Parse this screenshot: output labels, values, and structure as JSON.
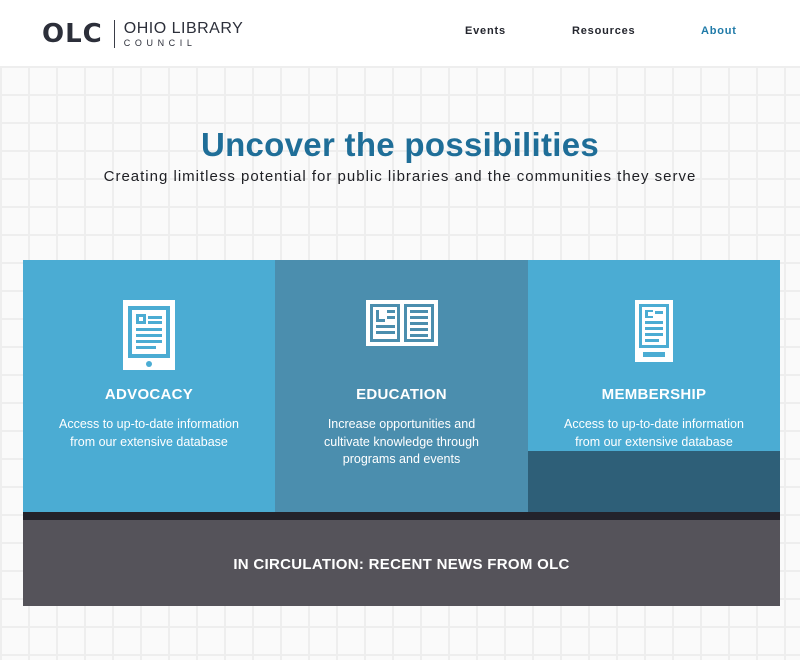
{
  "header": {
    "logo_mark": "OLC",
    "logo_line1": "OHIO LIBRARY",
    "logo_line2": "COUNCIL",
    "nav": [
      {
        "label": "Events"
      },
      {
        "label": "Resources"
      },
      {
        "label": "About"
      }
    ]
  },
  "hero": {
    "title": "Uncover the possibilities",
    "subtitle": "Creating limitless potential for public libraries and the communities they serve"
  },
  "cards": [
    {
      "title": "ADVOCACY",
      "description": "Access to up-to-date information from our extensive database",
      "icon": "tablet-document-icon"
    },
    {
      "title": "EDUCATION",
      "description": "Increase opportunities and cultivate knowledge through programs and events",
      "icon": "open-book-icon"
    },
    {
      "title": "MEMBERSHIP",
      "description": "Access to up-to-date information from our extensive database",
      "icon": "phone-card-icon"
    }
  ],
  "news": {
    "title": "IN CIRCULATION: RECENT NEWS FROM OLC"
  },
  "colors": {
    "accent": "#1f6e98",
    "nav_active": "#1f7aa8",
    "card_light": "#4bacd3",
    "card_mid": "#4b8eae",
    "card_dark_overlay": "#2e5f78",
    "news_bg": "#55535a"
  }
}
